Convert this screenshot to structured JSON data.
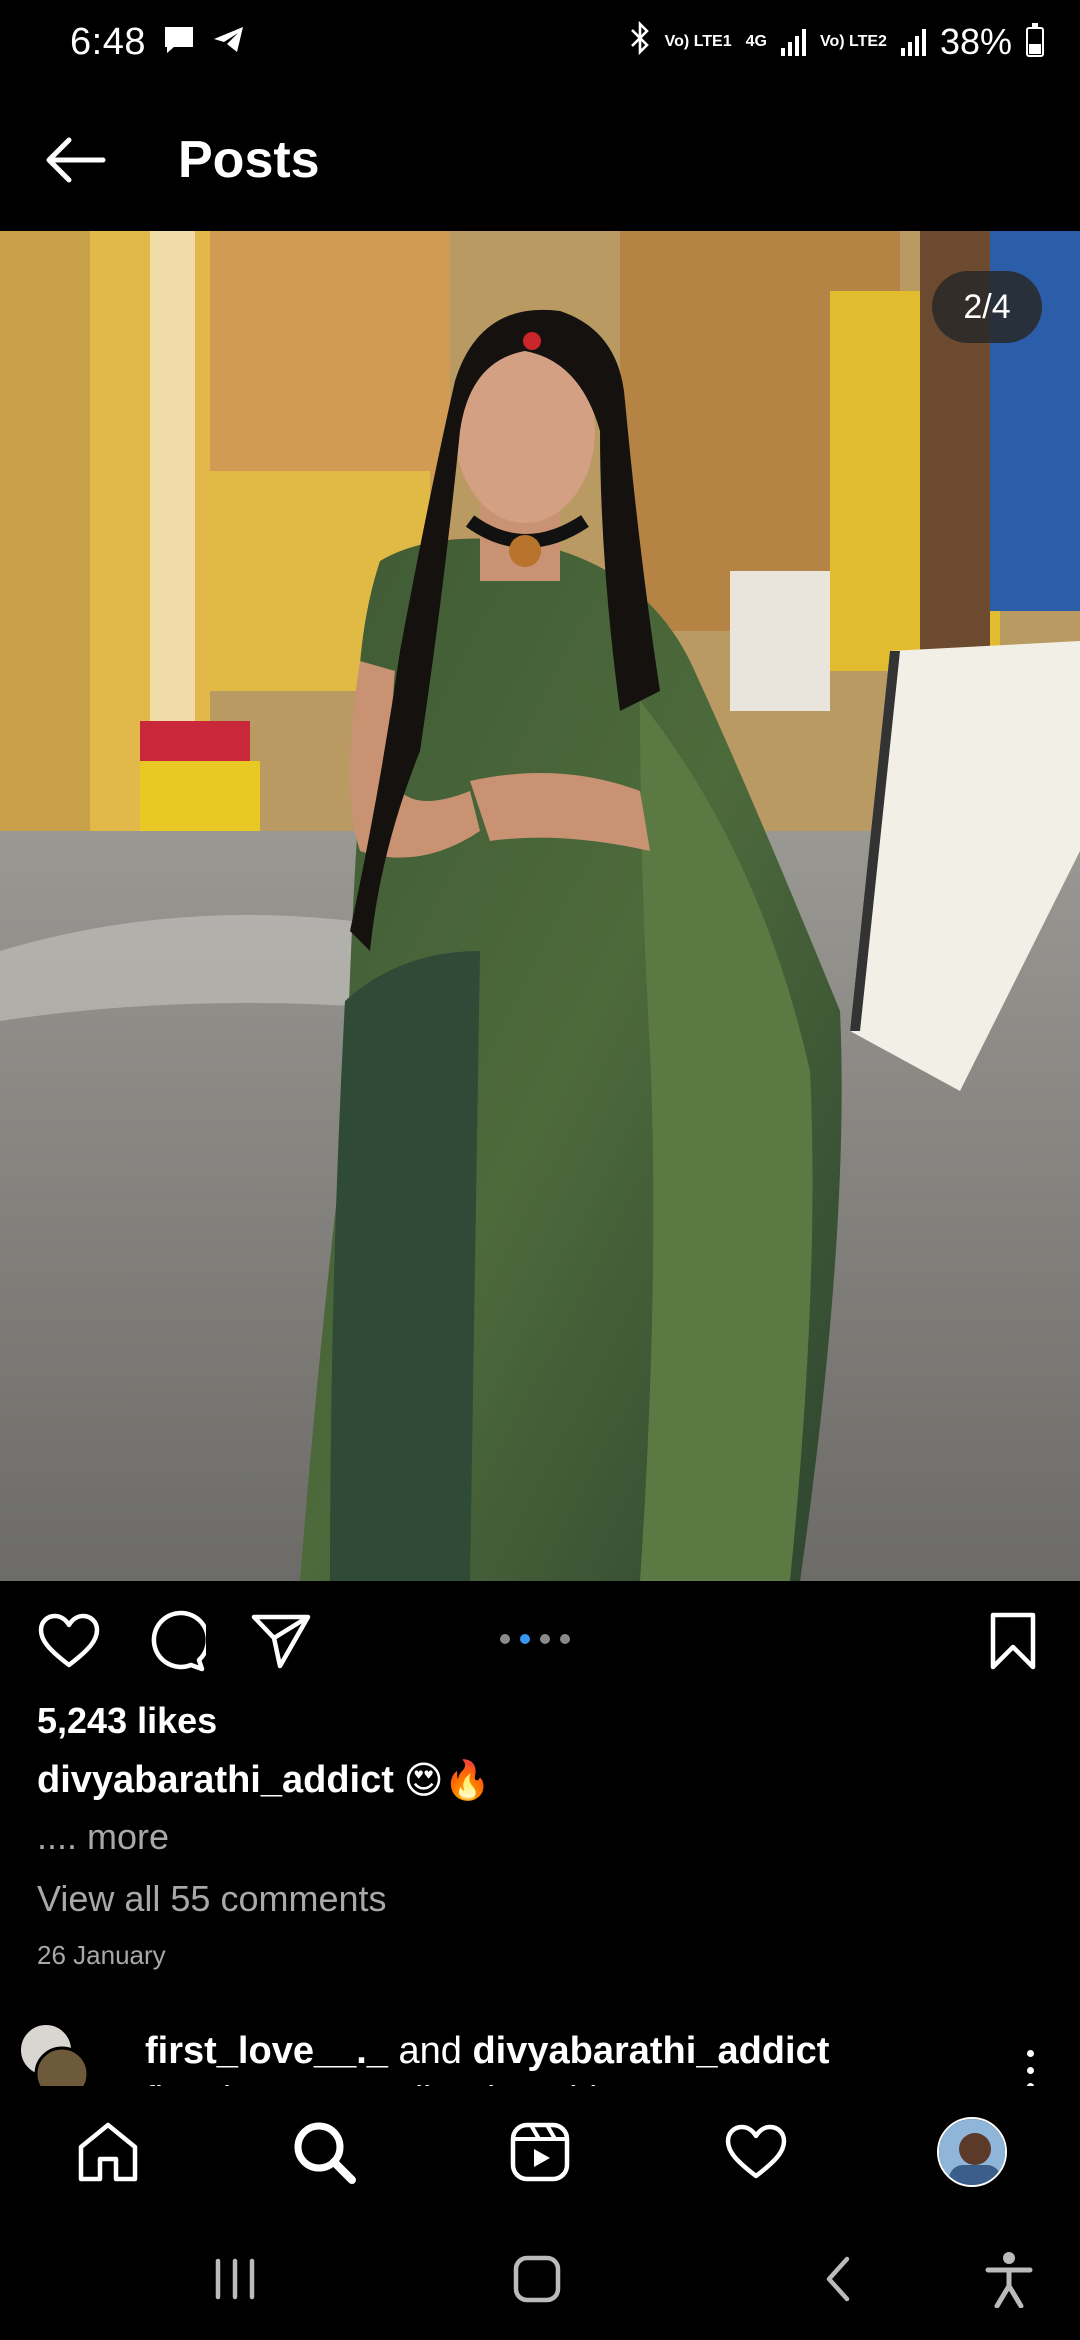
{
  "status_bar": {
    "time": "6:48",
    "sim1_label": "Vo) LTE1",
    "network_type": "4G",
    "sim2_label": "Vo) LTE2",
    "battery": "38%",
    "icons": [
      "message-icon",
      "telegram-icon",
      "bluetooth-icon",
      "signal-icon",
      "battery-icon"
    ]
  },
  "header": {
    "title": "Posts"
  },
  "post": {
    "media_counter": "2/4",
    "carousel": {
      "count": 4,
      "active_index": 1
    },
    "likes": "5,243 likes",
    "username": "divyabarathi_addict",
    "caption_emojis": "😍🔥",
    "more_label": ".... more",
    "view_comments": "View all 55 comments",
    "date": "26 January"
  },
  "next_post": {
    "user1": "first_love__._",
    "joiner": "and",
    "user2": "divyabarathi_addict",
    "subtitle": "first_love__._ & divyabarathi..."
  },
  "bottom_nav": {
    "items": [
      "home-icon",
      "search-icon",
      "reels-icon",
      "activity-heart-icon",
      "profile-avatar"
    ]
  },
  "colors": {
    "background": "#000000",
    "text": "#ffffff",
    "muted": "#a8a8a8",
    "active_dot": "#3897f0"
  }
}
